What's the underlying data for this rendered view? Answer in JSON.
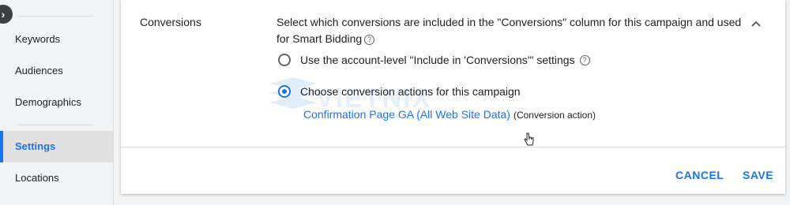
{
  "sidebar": {
    "items": [
      {
        "label": "Keywords"
      },
      {
        "label": "Audiences"
      },
      {
        "label": "Demographics"
      },
      {
        "label": "Settings"
      },
      {
        "label": "Locations"
      }
    ],
    "active_item": "Settings",
    "collapse_icon": "chevron-right-icon"
  },
  "conversions": {
    "title": "Conversions",
    "description": "Select which conversions are included in the \"Conversions\" column for this campaign and used for Smart Bidding",
    "options": [
      {
        "label": "Use the account-level \"Include in 'Conversions'\" settings",
        "selected": false
      },
      {
        "label": "Choose conversion actions for this campaign",
        "selected": true
      }
    ],
    "selected_action": {
      "name": "Confirmation Page GA (All Web Site Data)",
      "type": "(Conversion action)"
    }
  },
  "actions": {
    "cancel": "CANCEL",
    "save": "SAVE"
  },
  "watermark": {
    "text": "VIETNIX"
  },
  "colors": {
    "accent": "#1a73e8",
    "background": "#f1f3f4",
    "card": "#ffffff"
  }
}
